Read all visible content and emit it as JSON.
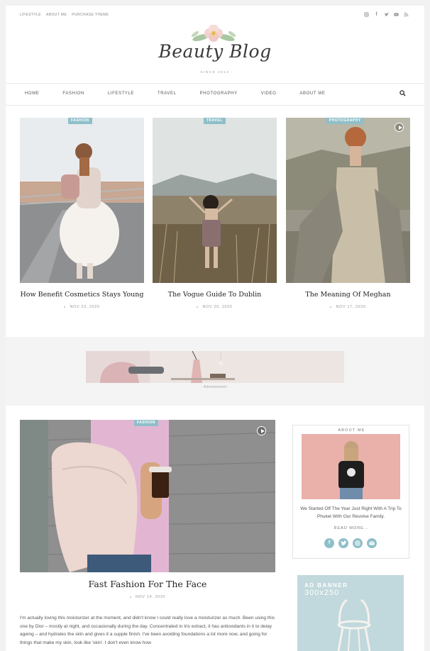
{
  "topbar": {
    "links": [
      "LIFESTYLE",
      "ABOUT ME",
      "PURCHASE THEME"
    ],
    "social_icons": [
      "instagram-icon",
      "facebook-icon",
      "twitter-icon",
      "youtube-icon",
      "rss-icon"
    ]
  },
  "logo": {
    "script": "Beauty Blog",
    "since": "- SINCE 2012 -"
  },
  "nav": {
    "items": [
      "HOME",
      "FASHION",
      "LIFESTYLE",
      "TRAVEL",
      "PHOTOGRAPHY",
      "VIDEO",
      "ABOUT ME"
    ],
    "search_icon": "search-icon"
  },
  "featured": [
    {
      "tag": "FASHION",
      "title": "How Benefit Cosmetics Stays Young",
      "date": "NOV 23, 2020",
      "video": false
    },
    {
      "tag": "TRAVEL",
      "title": "The Vogue Guide To Dublin",
      "date": "NOV 20, 2020",
      "video": false
    },
    {
      "tag": "PHOTOGRAPHY",
      "title": "The Meaning Of Meghan",
      "date": "NOV 17, 2020",
      "video": true
    }
  ],
  "ad": {
    "label": "- Advertisement -"
  },
  "main_post": {
    "tag": "FASHION",
    "title": "Fast Fashion For The Face",
    "date": "NOV 14, 2020",
    "excerpt": "I'm actually loving this moisturizer at the moment, and didn't know I could really love a moisturizer as much. Been using this one by Dior – mostly at night, and occasionally during the day. Concentrated in Iris extract, it has antioxidants in it to delay ageing – and hydrates the skin and gives it a supple finish. I've been avoiding foundations a lot more now, and going for things that make my skin, look like 'skin'. I don't even know how"
  },
  "sidebar": {
    "about_heading": "ABOUT ME",
    "about_text": "We Started Off The Year Just Right With A Trip To Phuket With Our Revolve Family.",
    "read_more": "READ MORE...",
    "social_icons": [
      "facebook-icon",
      "twitter-icon",
      "instagram-icon",
      "email-icon"
    ],
    "banner_line1": "AD BANNER",
    "banner_line2": "300x250"
  },
  "colors": {
    "accent": "#8fbfc9",
    "background": "#f2f2f2"
  }
}
